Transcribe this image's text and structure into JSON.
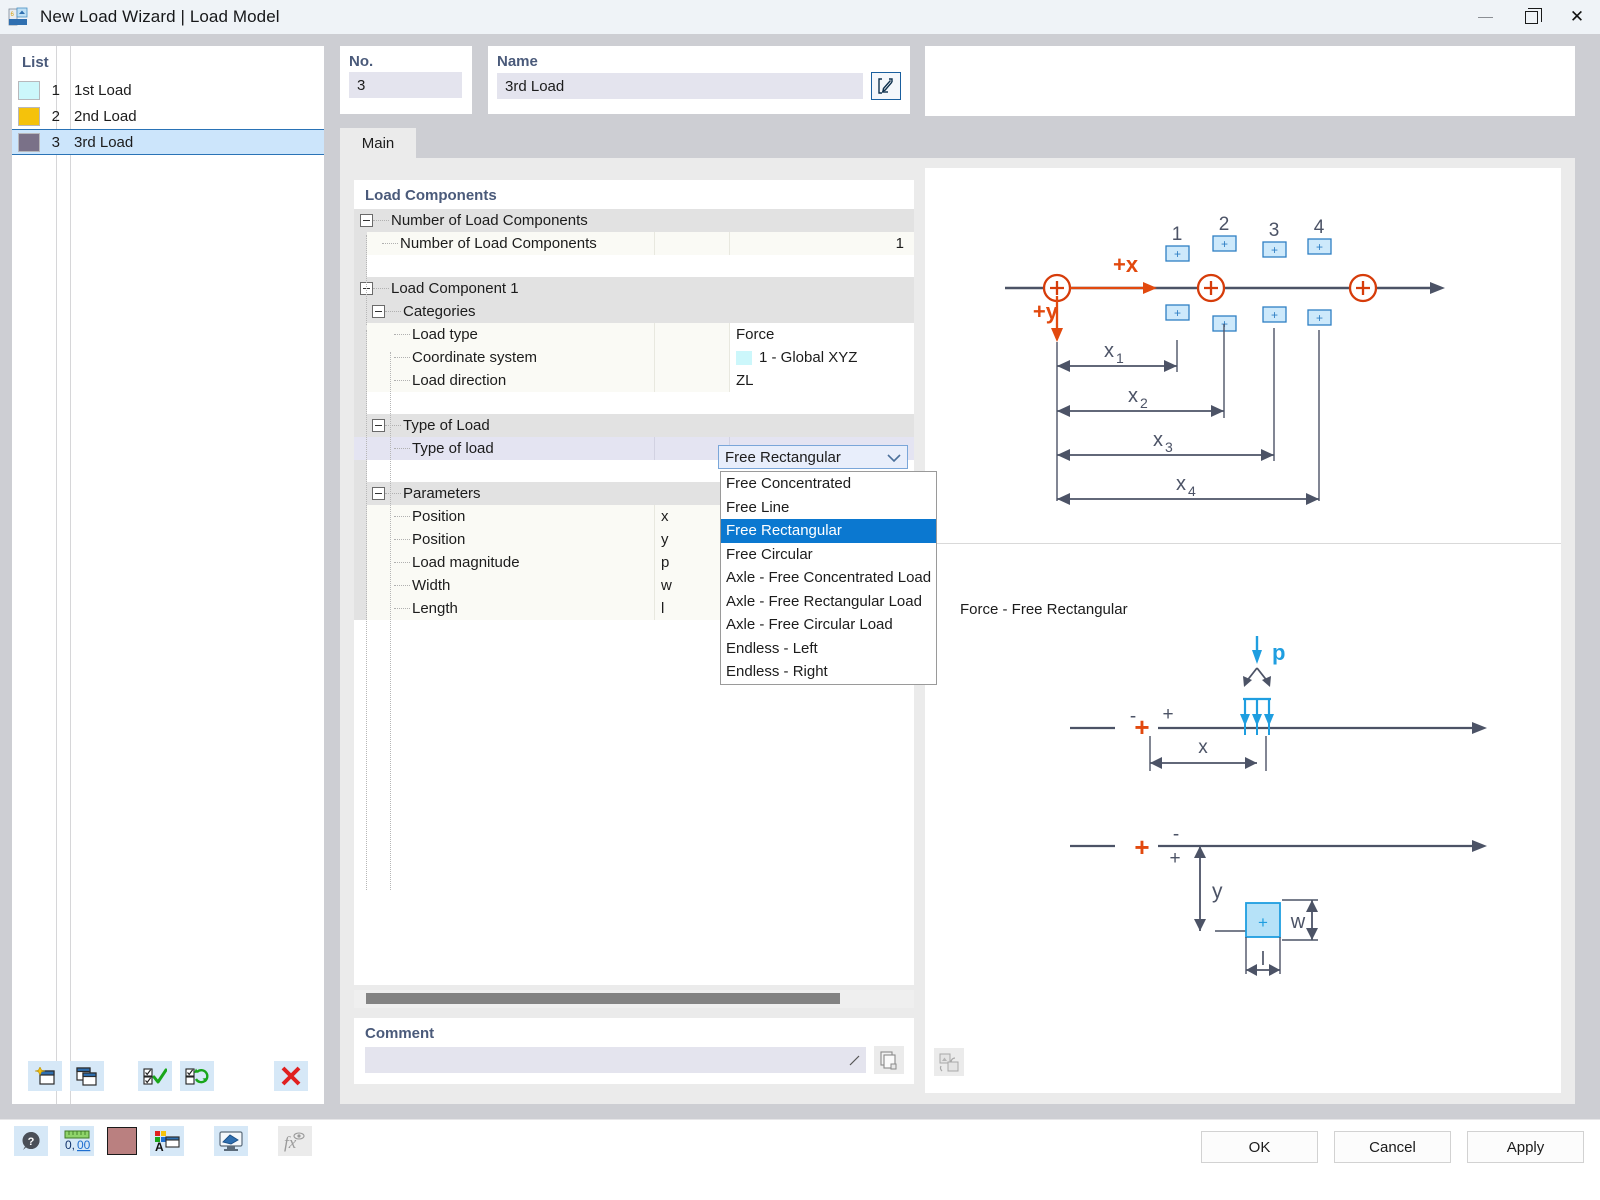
{
  "window": {
    "title": "New Load Wizard | Load Model",
    "app_icon": "load-model-icon",
    "minimize_label": "",
    "maximize_label": "",
    "close_label": "✕"
  },
  "list_panel": {
    "title": "List",
    "rows": [
      {
        "no": "1",
        "name": "1st Load",
        "color": "#ccf7fb",
        "selected": false
      },
      {
        "no": "2",
        "name": "2nd Load",
        "color": "#f5c20b",
        "selected": false
      },
      {
        "no": "3",
        "name": "3rd Load",
        "color": "#7a7188",
        "selected": true
      }
    ],
    "toolbar": [
      {
        "name": "new-item-button",
        "icon": "new-window-star-icon"
      },
      {
        "name": "copy-item-button",
        "icon": "copy-window-icon"
      },
      {
        "name": "select-all-button",
        "icon": "checklist-check-icon"
      },
      {
        "name": "invert-selection-button",
        "icon": "checklist-refresh-icon"
      },
      {
        "name": "delete-item-button",
        "icon": "red-x-icon"
      }
    ]
  },
  "no_panel": {
    "title": "No.",
    "value": "3"
  },
  "name_panel": {
    "title": "Name",
    "value": "3rd Load",
    "edit_button_icon": "edit-pencil-icon"
  },
  "tabs": [
    {
      "label": "Main",
      "active": true
    }
  ],
  "tree": {
    "title": "Load Components",
    "rows": [
      {
        "type": "group",
        "depth": 0,
        "label": "Number of Load Components",
        "mid": "",
        "value": ""
      },
      {
        "type": "leaf",
        "depth": 1,
        "label": "Number of Load Components",
        "mid": "",
        "value": "1",
        "align": "right"
      },
      {
        "type": "blank",
        "depth": 1,
        "label": "",
        "mid": "",
        "value": ""
      },
      {
        "type": "group",
        "depth": 0,
        "label": "Load Component 1",
        "mid": "",
        "value": ""
      },
      {
        "type": "group",
        "depth": 1,
        "label": "Categories",
        "mid": "",
        "value": ""
      },
      {
        "type": "leaf",
        "depth": 2,
        "label": "Load type",
        "mid": "",
        "value": "Force"
      },
      {
        "type": "leaf",
        "depth": 2,
        "label": "Coordinate system",
        "mid": "",
        "value": "1 - Global XYZ",
        "swatch": "#ccf7fb"
      },
      {
        "type": "leaf",
        "depth": 2,
        "label": "Load direction",
        "mid": "",
        "value": "ZL"
      },
      {
        "type": "blank",
        "depth": 2,
        "label": "",
        "mid": "",
        "value": ""
      },
      {
        "type": "group",
        "depth": 1,
        "label": "Type of Load",
        "mid": "",
        "value": ""
      },
      {
        "type": "sel",
        "depth": 2,
        "label": "Type of load",
        "mid": "",
        "value": ""
      },
      {
        "type": "blank",
        "depth": 2,
        "label": "",
        "mid": "",
        "value": ""
      },
      {
        "type": "group",
        "depth": 1,
        "label": "Parameters",
        "mid": "",
        "value": ""
      },
      {
        "type": "leaf",
        "depth": 2,
        "label": "Position",
        "mid": "x",
        "value": ""
      },
      {
        "type": "leaf",
        "depth": 2,
        "label": "Position",
        "mid": "y",
        "value": ""
      },
      {
        "type": "leaf",
        "depth": 2,
        "label": "Load magnitude",
        "mid": "p",
        "value": ""
      },
      {
        "type": "leaf",
        "depth": 2,
        "label": "Width",
        "mid": "w",
        "value": ""
      },
      {
        "type": "leaf",
        "depth": 2,
        "label": "Length",
        "mid": "l",
        "value": ""
      }
    ]
  },
  "combo": {
    "selected": "Free Rectangular",
    "expanded": true,
    "options": [
      {
        "label": "Free Concentrated",
        "active": false
      },
      {
        "label": "Free Line",
        "active": false
      },
      {
        "label": "Free Rectangular",
        "active": true
      },
      {
        "label": "Free Circular",
        "active": false
      },
      {
        "label": "Axle - Free Concentrated Load",
        "active": false
      },
      {
        "label": "Axle - Free Rectangular Load",
        "active": false
      },
      {
        "label": "Axle - Free Circular Load",
        "active": false
      },
      {
        "label": "Endless - Left",
        "active": false
      },
      {
        "label": "Endless - Right",
        "active": false
      }
    ]
  },
  "comment": {
    "title": "Comment",
    "value": "",
    "placeholder": "",
    "copy_button_icon": "copy-pages-icon"
  },
  "graphic": {
    "caption": "Force - Free Rectangular",
    "top_diagram": {
      "axis_labels": {
        "x": "+x",
        "y": "+y"
      },
      "node_numbers": [
        "1",
        "2",
        "3",
        "4"
      ],
      "dimension_labels": [
        "x",
        "x",
        "x",
        "x"
      ],
      "dimension_subscripts": [
        "1",
        "2",
        "3",
        "4"
      ]
    },
    "bottom_diagram": {
      "load_label": "p",
      "x_label": "x",
      "y_label": "y",
      "w_label": "w",
      "l_label": "l",
      "sign_plus": "+",
      "sign_minus": "-",
      "origin_plus": "+"
    },
    "bottom_button_icon": "swap-image-icon"
  },
  "bottom_toolbar": [
    {
      "name": "help-button",
      "icon": "help-question-icon"
    },
    {
      "name": "units-button",
      "icon": "units-ruler-icon"
    },
    {
      "name": "color-button",
      "icon": "color-swatch-icon",
      "color": "#ba8080"
    },
    {
      "name": "display-properties-button",
      "icon": "palette-window-icon"
    },
    {
      "name": "render-button",
      "icon": "render-monitor-icon"
    },
    {
      "name": "formula-button",
      "icon": "fx-icon",
      "disabled": true
    }
  ],
  "dialog_buttons": [
    {
      "label": "OK",
      "name": "ok-button"
    },
    {
      "label": "Cancel",
      "name": "cancel-button"
    },
    {
      "label": "Apply",
      "name": "apply-button"
    }
  ]
}
